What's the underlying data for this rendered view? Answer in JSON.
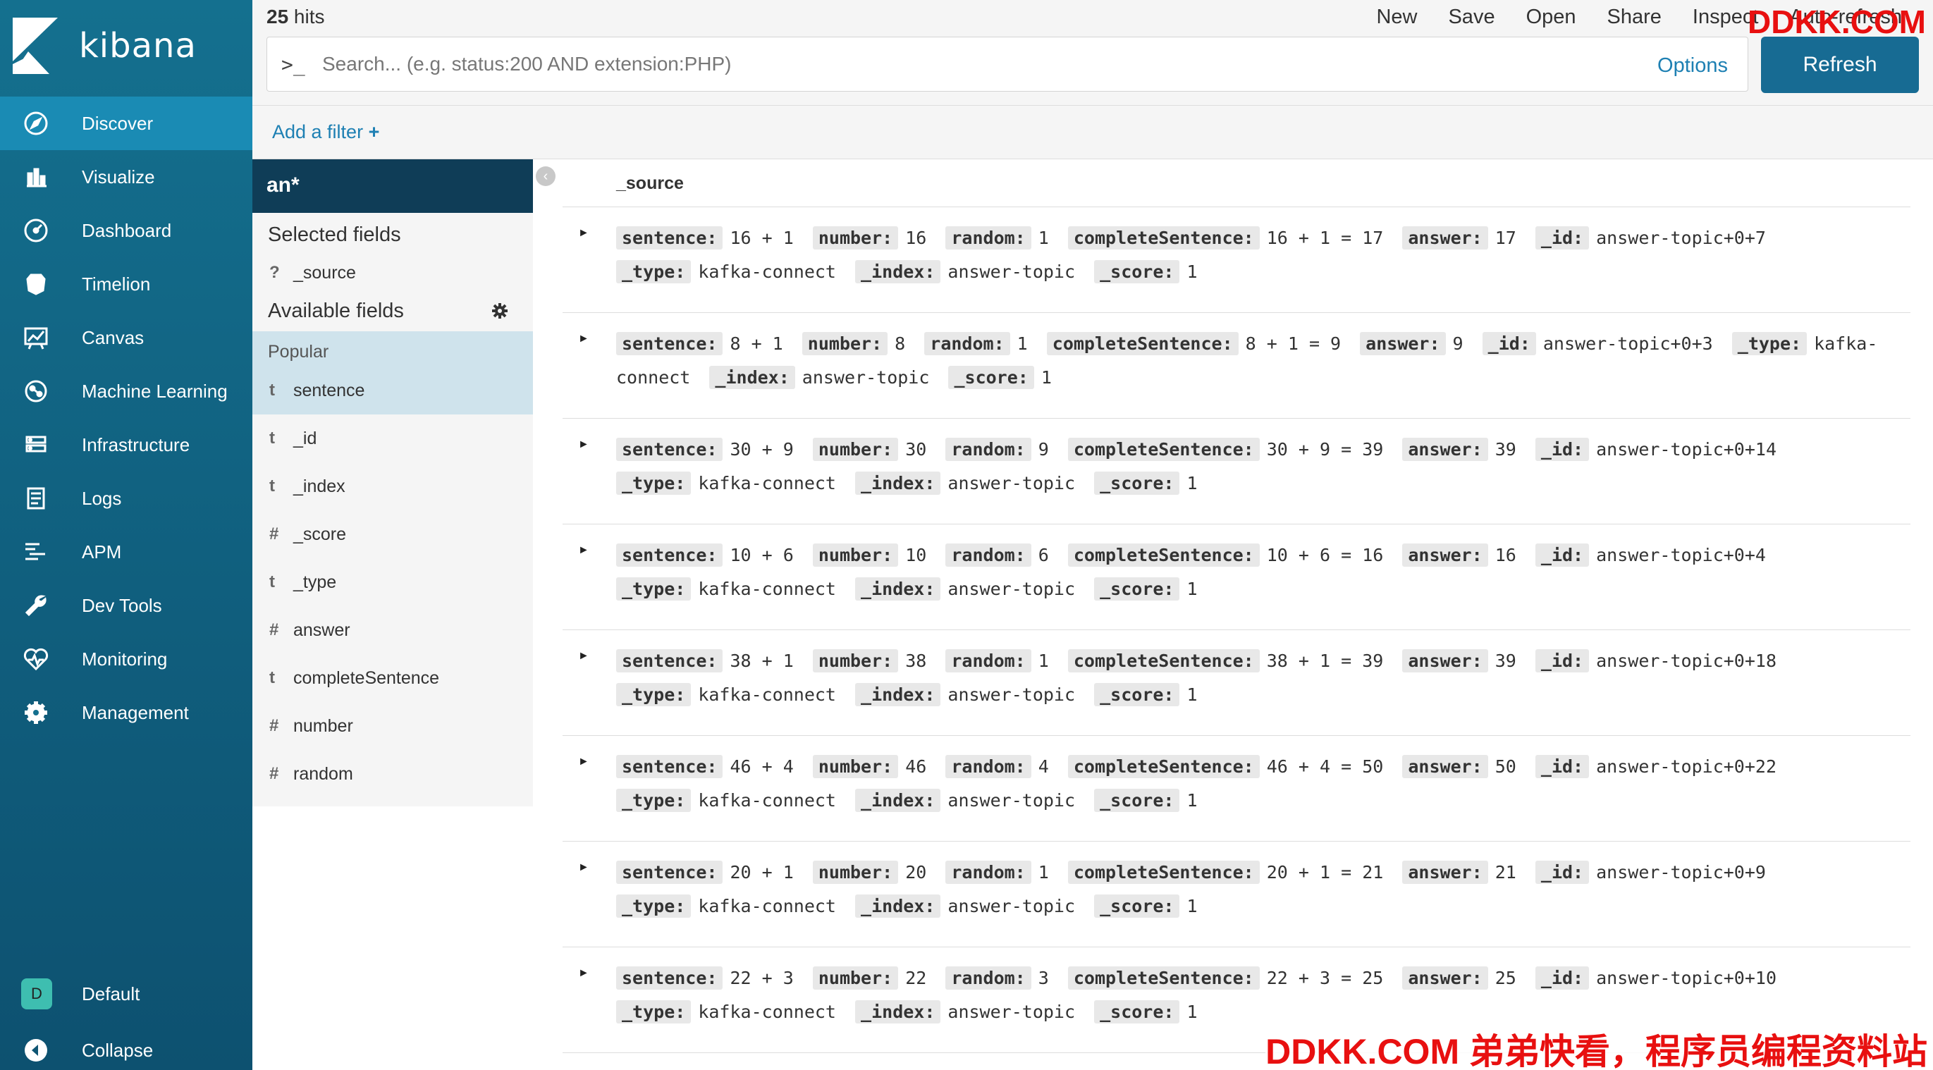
{
  "brand": {
    "name": "kibana"
  },
  "sidebar": {
    "items": [
      {
        "label": "Discover",
        "icon": "compass-icon",
        "active": true
      },
      {
        "label": "Visualize",
        "icon": "bar-chart-icon"
      },
      {
        "label": "Dashboard",
        "icon": "dashboard-icon"
      },
      {
        "label": "Timelion",
        "icon": "timelion-icon"
      },
      {
        "label": "Canvas",
        "icon": "canvas-icon"
      },
      {
        "label": "Machine Learning",
        "icon": "ml-icon"
      },
      {
        "label": "Infrastructure",
        "icon": "infrastructure-icon"
      },
      {
        "label": "Logs",
        "icon": "logs-icon"
      },
      {
        "label": "APM",
        "icon": "apm-icon"
      },
      {
        "label": "Dev Tools",
        "icon": "wrench-icon"
      },
      {
        "label": "Monitoring",
        "icon": "heartbeat-icon"
      },
      {
        "label": "Management",
        "icon": "gear-icon"
      }
    ],
    "space": {
      "badge": "D",
      "label": "Default"
    },
    "collapse": {
      "label": "Collapse"
    }
  },
  "topbar": {
    "hits_count": "25",
    "hits_label": " hits",
    "menu": [
      "New",
      "Save",
      "Open",
      "Share",
      "Inspect",
      "Auto-refresh"
    ],
    "search_prompt": ">_",
    "search_placeholder": "Search... (e.g. status:200 AND extension:PHP)",
    "options_label": "Options",
    "refresh_label": "Refresh"
  },
  "filters": {
    "add_label": "Add a filter",
    "add_icon": "+"
  },
  "fields_panel": {
    "index_pattern": "an*",
    "selected_title": "Selected fields",
    "selected": [
      {
        "type": "?",
        "name": "_source"
      }
    ],
    "available_title": "Available fields",
    "popular_title": "Popular",
    "popular": [
      {
        "type": "t",
        "name": "sentence"
      }
    ],
    "available": [
      {
        "type": "t",
        "name": "_id"
      },
      {
        "type": "t",
        "name": "_index"
      },
      {
        "type": "#",
        "name": "_score"
      },
      {
        "type": "t",
        "name": "_type"
      },
      {
        "type": "#",
        "name": "answer"
      },
      {
        "type": "t",
        "name": "completeSentence"
      },
      {
        "type": "#",
        "name": "number"
      },
      {
        "type": "#",
        "name": "random"
      }
    ]
  },
  "documents": {
    "column": "_source",
    "rows": [
      {
        "sentence": "16 + 1",
        "number": "16",
        "random": "1",
        "completeSentence": "16 + 1 = 17",
        "answer": "17",
        "_id": "answer-topic+0+7",
        "_type": "kafka-connect",
        "_index": "answer-topic",
        "_score": "1"
      },
      {
        "sentence": "8 + 1",
        "number": "8",
        "random": "1",
        "completeSentence": "8 + 1 = 9",
        "answer": "9",
        "_id": "answer-topic+0+3",
        "_type": "kafka-connect",
        "_index": "answer-topic",
        "_score": "1"
      },
      {
        "sentence": "30 + 9",
        "number": "30",
        "random": "9",
        "completeSentence": "30 + 9 = 39",
        "answer": "39",
        "_id": "answer-topic+0+14",
        "_type": "kafka-connect",
        "_index": "answer-topic",
        "_score": "1"
      },
      {
        "sentence": "10 + 6",
        "number": "10",
        "random": "6",
        "completeSentence": "10 + 6 = 16",
        "answer": "16",
        "_id": "answer-topic+0+4",
        "_type": "kafka-connect",
        "_index": "answer-topic",
        "_score": "1"
      },
      {
        "sentence": "38 + 1",
        "number": "38",
        "random": "1",
        "completeSentence": "38 + 1 = 39",
        "answer": "39",
        "_id": "answer-topic+0+18",
        "_type": "kafka-connect",
        "_index": "answer-topic",
        "_score": "1"
      },
      {
        "sentence": "46 + 4",
        "number": "46",
        "random": "4",
        "completeSentence": "46 + 4 = 50",
        "answer": "50",
        "_id": "answer-topic+0+22",
        "_type": "kafka-connect",
        "_index": "answer-topic",
        "_score": "1"
      },
      {
        "sentence": "20 + 1",
        "number": "20",
        "random": "1",
        "completeSentence": "20 + 1 = 21",
        "answer": "21",
        "_id": "answer-topic+0+9",
        "_type": "kafka-connect",
        "_index": "answer-topic",
        "_score": "1"
      },
      {
        "sentence": "22 + 3",
        "number": "22",
        "random": "3",
        "completeSentence": "22 + 3 = 25",
        "answer": "25",
        "_id": "answer-topic+0+10",
        "_type": "kafka-connect",
        "_index": "answer-topic",
        "_score": "1"
      }
    ]
  },
  "watermark": {
    "top": "DDKK.COM",
    "bottom": "DDKK.COM 弟弟快看，程序员编程资料站"
  },
  "colors": {
    "sidebar": "#14708f",
    "active": "#1a8bb4",
    "link": "#1e80b3",
    "refresh": "#176b93",
    "index_bar": "#0f3d57",
    "watermark": "#e81010"
  }
}
